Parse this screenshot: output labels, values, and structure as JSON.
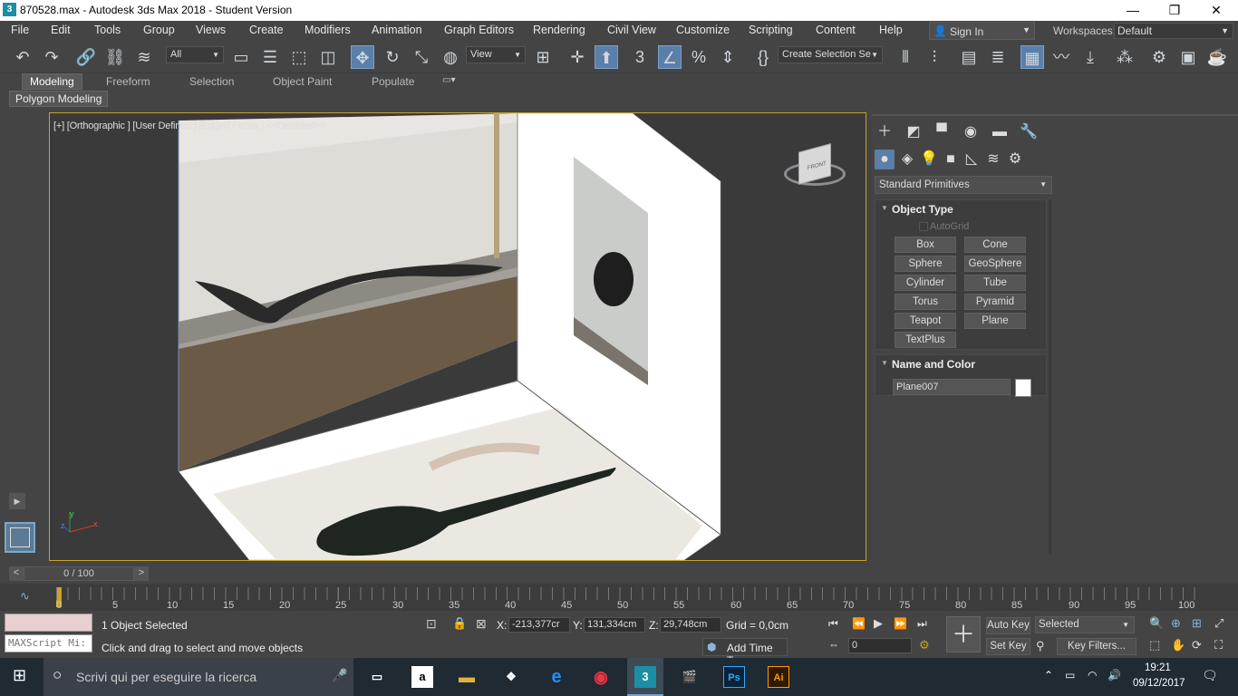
{
  "window": {
    "title": "870528.max - Autodesk 3ds Max 2018 - Student Version",
    "app_icon": "3"
  },
  "menubar": {
    "items": [
      "File",
      "Edit",
      "Tools",
      "Group",
      "Views",
      "Create",
      "Modifiers",
      "Animation",
      "Graph Editors",
      "Rendering",
      "Civil View",
      "Customize",
      "Scripting",
      "Content",
      "Help"
    ],
    "sign_in": "Sign In",
    "workspaces_label": "Workspaces:",
    "workspace_value": "Default"
  },
  "toolbar": {
    "selection_filter": "All",
    "ref_coord": "View",
    "selection_set_placeholder": "Create Selection Se"
  },
  "ribbon": {
    "tabs": [
      "Modeling",
      "Freeform",
      "Selection",
      "Object Paint",
      "Populate"
    ],
    "panel": "Polygon Modeling"
  },
  "viewport": {
    "label": "[+] [Orthographic ] [User Defined ] [Edged Faces ]  <<Disabled>>",
    "viewcube_face": "FRONT",
    "axis_x": "x",
    "axis_y": "y",
    "axis_z": "z"
  },
  "command_panel": {
    "category": "Standard Primitives",
    "object_type": {
      "title": "Object Type",
      "autogrid": "AutoGrid",
      "buttons": [
        "Box",
        "Cone",
        "Sphere",
        "GeoSphere",
        "Cylinder",
        "Tube",
        "Torus",
        "Pyramid",
        "Teapot",
        "Plane",
        "TextPlus"
      ]
    },
    "name_and_color": {
      "title": "Name and Color",
      "name": "Plane007",
      "color": "#ffffff"
    }
  },
  "timeline": {
    "slider": "0 / 100",
    "ticks": [
      "0",
      "5",
      "10",
      "15",
      "20",
      "25",
      "30",
      "35",
      "40",
      "45",
      "50",
      "55",
      "60",
      "65",
      "70",
      "75",
      "80",
      "85",
      "90",
      "95",
      "100"
    ]
  },
  "status": {
    "maxscript": "MAXScript Mi:",
    "selected": "1 Object Selected",
    "prompt": "Click and drag to select and move objects",
    "x_label": "X:",
    "x": "-213,377cr",
    "y_label": "Y:",
    "y": "131,334cm",
    "z_label": "Z:",
    "z": "29,748cm",
    "grid": "Grid = 0,0cm",
    "add_time_tag": "Add Time Tag",
    "auto_key": "Auto Key",
    "set_key": "Set Key",
    "key_mode": "Selected",
    "key_filters": "Key Filters...",
    "frame": "0"
  },
  "taskbar": {
    "search_placeholder": "Scrivi qui per eseguire la ricerca",
    "time": "19:21",
    "date": "09/12/2017",
    "apps": [
      "a",
      "",
      "",
      "e",
      "",
      "3",
      "",
      "Ps",
      "Ai"
    ]
  },
  "colors": {
    "accent": "#5a7fa8",
    "viewport_border": "#c9a227"
  }
}
